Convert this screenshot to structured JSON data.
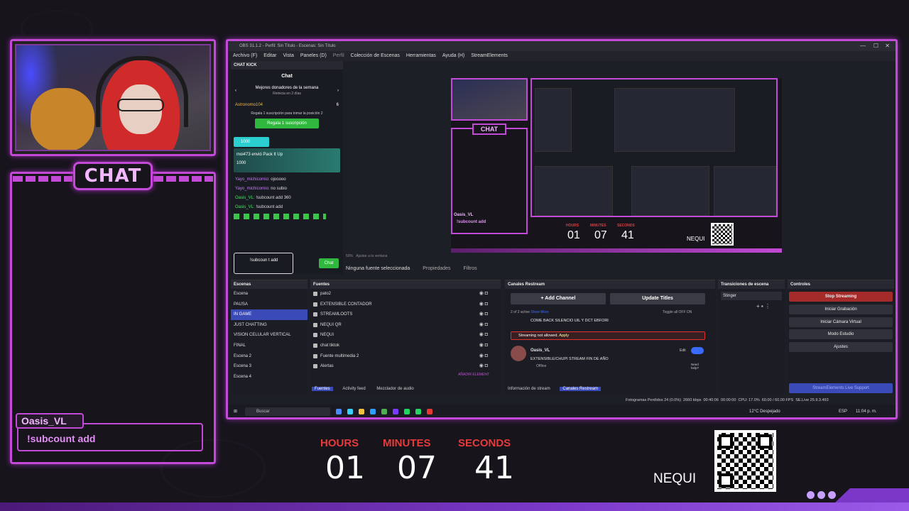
{
  "overlay": {
    "chat_title": "CHAT",
    "chat_user": "Oasis_VL",
    "chat_message": "!subcount add",
    "timer": {
      "hours_label": "HOURS",
      "minutes_label": "MINUTES",
      "seconds_label": "SECONDS",
      "hours": "01",
      "minutes": "07",
      "seconds": "41"
    },
    "nequi": "NEQUI"
  },
  "obs": {
    "title": "OBS 31.1.2 - Perfil: Sin Título - Escenas: Sin Título",
    "menu": [
      "Archivo (F)",
      "Editar",
      "Vista",
      "Paneles (D)",
      "Perfil",
      "Colección de Escenas",
      "Herramientas",
      "Ayuda (H)",
      "StreamElements"
    ],
    "kick": {
      "dock_title": "CHAT KICK",
      "chat_label": "Chat",
      "donors_title": "Mejores donadores de la semana",
      "donors_sub": "Reinicia en 2 días",
      "top_user": "Astronomo104",
      "top_count": "6",
      "hint": "Regala 1 suscripción para tomar la posición 2",
      "gift_button": "Regala 1 suscripción",
      "badge_amount": "1000",
      "pack_text": "moi473 envió Pack It Up",
      "pack_amount": "1000",
      "messages": [
        {
          "user": "Yayo_michicornio:",
          "text": "ojooooo"
        },
        {
          "user": "Yayo_michicornio:",
          "text": "no subio"
        },
        {
          "user": "Oasis_VL:",
          "text": "!subcount add 360"
        },
        {
          "user": "Oasis_VL:",
          "text": "!subcount add"
        }
      ],
      "input_value": "!subcoun t add",
      "send_button": "Chat"
    },
    "preview": {
      "chat_title": "CHAT",
      "user": "Oasis_VL",
      "message": "!subcount add",
      "timer_labels": [
        "HOURS",
        "MINUTES",
        "SECONDS"
      ],
      "timer_values": [
        "01",
        "07",
        "41"
      ],
      "nequi": "NEQUI"
    },
    "preview_status": {
      "zoom": "50%",
      "fit": "Ajustar a la ventana"
    },
    "selection_bar": {
      "none_selected": "Ninguna fuente seleccionada",
      "properties": "Propiedades",
      "filters": "Filtros"
    },
    "scenes": {
      "title": "Escenas",
      "items": [
        "Escena",
        "PAUSA",
        "IN GAME",
        "JUST CHATTING",
        "VISION CELULAR VERTICAL",
        "FINAL",
        "Escena 2",
        "Escena 3",
        "Escena 4"
      ],
      "selected": 2
    },
    "sources": {
      "title": "Fuentes",
      "items": [
        "pato2",
        "EXTENSIBLE CONTADOR",
        "STREAMLOOTS",
        "NEQUI QR",
        "NEQUI",
        "chat tiktok",
        "Fuente multimedia 2",
        "Alertas"
      ],
      "add_element": "AÑADIR ELEMENT"
    },
    "bottom_tabs": {
      "sources": "Fuentes",
      "activity": "Activity feed",
      "mixer": "Mezclador de audio"
    },
    "restream": {
      "title": "Canales Restream",
      "add_channel": "Add Channel",
      "update_titles": "Update Titles",
      "active": "2 of 2 active",
      "show_more": "Show More",
      "toggle_all": "Toggle all",
      "off": "OFF",
      "on": "ON",
      "title_line": "COME BACK SILENCIO UIL Y DCT EBFORI",
      "warning": "Streaming not allowed.",
      "apply": "Apply",
      "channel_name": "Oasis_VL",
      "channel_title": "EXTENSIBLE/CHUPI STREAM FIN DE AÑO",
      "status": "Offline",
      "edit": "Edit",
      "need_help": "Need help?",
      "tabs": [
        "Información de stream",
        "Canales Restream"
      ]
    },
    "transitions": {
      "title": "Transiciones de escena",
      "value": "Stinger"
    },
    "controls": {
      "title": "Controles",
      "buttons": [
        "Stop Streaming",
        "Iniciar Grabación",
        "Iniciar Cámara Virtual",
        "Modo Estudio",
        "Ajustes"
      ],
      "support": "StreamElements Live Support"
    },
    "statusbar": {
      "frames": "Fotogramas Perdidos 24 (0.0%)",
      "kbps": "2660 kbps",
      "live_time": "00:40:06",
      "rec_time": "00:00:00",
      "cpu": "CPU: 17.0%",
      "fps": "60.00 / 60.00 FPS",
      "se": "SE.Live 25.9.3.493"
    },
    "taskbar": {
      "search": "Buscar",
      "weather": "12°C Despejado",
      "lang": "ESP",
      "time": "11:04 p. m."
    }
  },
  "colors": {
    "accent": "#c24ad6",
    "timer_label": "#e63b3b",
    "kick_green": "#2fb83d",
    "obs_select": "#3a4bb8",
    "stop": "#a52a2a"
  }
}
